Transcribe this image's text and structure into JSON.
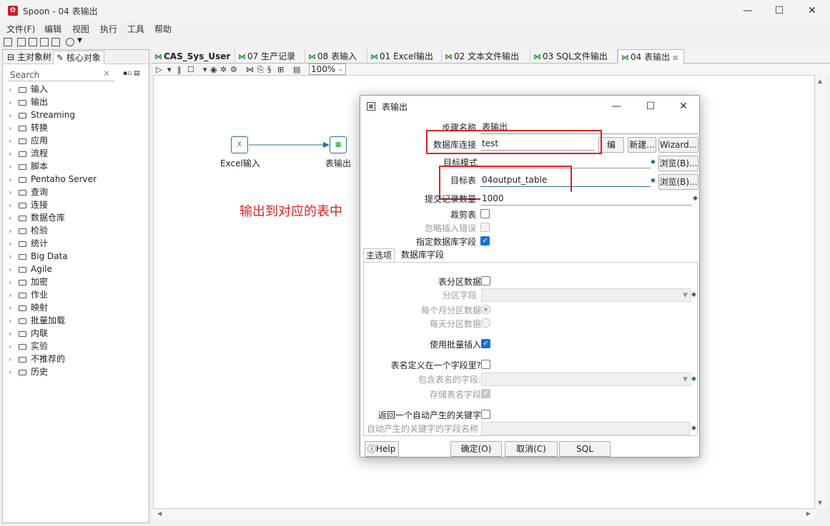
{
  "window": {
    "title": "Spoon - 04 表输出",
    "icon": "spoon-logo-icon"
  },
  "menu": [
    "文件(F)",
    "编辑",
    "视图",
    "执行",
    "工具",
    "帮助"
  ],
  "left_panel": {
    "tabs": [
      "主对象树",
      "核心对象"
    ],
    "search_placeholder": "Search",
    "tree": [
      "输入",
      "输出",
      "Streaming",
      "转换",
      "应用",
      "流程",
      "脚本",
      "Pentaho Server",
      "查询",
      "连接",
      "数据仓库",
      "检验",
      "统计",
      "Big Data",
      "Agile",
      "加密",
      "作业",
      "映射",
      "批量加载",
      "内联",
      "实验",
      "不推荐的",
      "历史"
    ]
  },
  "editor_tabs": [
    "CAS_Sys_User",
    "07 生产记录",
    "08 表输入",
    "01 Excel输出",
    "02 文本文件输出",
    "03 SQL文件输出",
    "04 表输出"
  ],
  "toolbar": {
    "zoom": "100%"
  },
  "canvas": {
    "steps": [
      {
        "label": "Excel输入",
        "icon": "excel-input-icon"
      },
      {
        "label": "表输出",
        "icon": "table-output-icon"
      }
    ],
    "annotation": "输出到对应的表中"
  },
  "dialog": {
    "title": "表输出",
    "step_name_label": "步骤名称",
    "step_name_value": "表输出",
    "db_conn_label": "数据库连接",
    "db_conn_value": "test",
    "edit_btn": "编辑...",
    "new_btn": "新建...",
    "wizard_btn": "Wizard...",
    "schema_label": "目标模式",
    "schema_value": "",
    "browse_btn": "浏览(B)...",
    "table_label": "目标表",
    "table_value": "04output_table",
    "commit_label": "提交记录数量",
    "commit_value": "1000",
    "truncate_label": "裁剪表",
    "ignore_errors_label": "忽略插入错误",
    "specify_fields_label": "指定数据库字段",
    "tabs": [
      "主选项",
      "数据库字段"
    ],
    "partition_label": "表分区数据",
    "partition_field_label": "分区字段",
    "monthly_label": "每个月分区数据",
    "daily_label": "每天分区数据",
    "batch_label": "使用批量插入",
    "tablename_in_field_label": "表名定义在一个字段里?",
    "tablename_field_label": "包含表名的字段:",
    "store_tablename_label": "存储表名字段",
    "return_key_label": "返回一个自动产生的关键字",
    "key_field_label": "自动产生的关键字的字段名称",
    "help_btn": "Help",
    "ok_btn": "确定(O)",
    "cancel_btn": "取消(C)",
    "sql_btn": "SQL"
  },
  "colors": {
    "annotation": "#e02020",
    "highlight_box": "#e02020",
    "checkbox_on": "#1a6fcf",
    "tab_icon": "#1a8f2e"
  }
}
